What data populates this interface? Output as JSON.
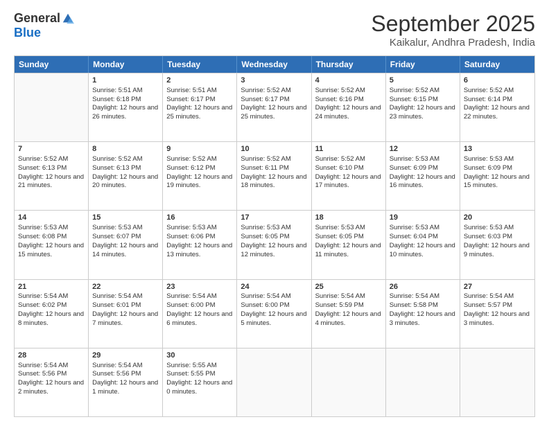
{
  "logo": {
    "general": "General",
    "blue": "Blue"
  },
  "title": "September 2025",
  "subtitle": "Kaikalur, Andhra Pradesh, India",
  "header_days": [
    "Sunday",
    "Monday",
    "Tuesday",
    "Wednesday",
    "Thursday",
    "Friday",
    "Saturday"
  ],
  "weeks": [
    [
      {
        "day": "",
        "sunrise": "",
        "sunset": "",
        "daylight": ""
      },
      {
        "day": "1",
        "sunrise": "Sunrise: 5:51 AM",
        "sunset": "Sunset: 6:18 PM",
        "daylight": "Daylight: 12 hours and 26 minutes."
      },
      {
        "day": "2",
        "sunrise": "Sunrise: 5:51 AM",
        "sunset": "Sunset: 6:17 PM",
        "daylight": "Daylight: 12 hours and 25 minutes."
      },
      {
        "day": "3",
        "sunrise": "Sunrise: 5:52 AM",
        "sunset": "Sunset: 6:17 PM",
        "daylight": "Daylight: 12 hours and 25 minutes."
      },
      {
        "day": "4",
        "sunrise": "Sunrise: 5:52 AM",
        "sunset": "Sunset: 6:16 PM",
        "daylight": "Daylight: 12 hours and 24 minutes."
      },
      {
        "day": "5",
        "sunrise": "Sunrise: 5:52 AM",
        "sunset": "Sunset: 6:15 PM",
        "daylight": "Daylight: 12 hours and 23 minutes."
      },
      {
        "day": "6",
        "sunrise": "Sunrise: 5:52 AM",
        "sunset": "Sunset: 6:14 PM",
        "daylight": "Daylight: 12 hours and 22 minutes."
      }
    ],
    [
      {
        "day": "7",
        "sunrise": "Sunrise: 5:52 AM",
        "sunset": "Sunset: 6:13 PM",
        "daylight": "Daylight: 12 hours and 21 minutes."
      },
      {
        "day": "8",
        "sunrise": "Sunrise: 5:52 AM",
        "sunset": "Sunset: 6:13 PM",
        "daylight": "Daylight: 12 hours and 20 minutes."
      },
      {
        "day": "9",
        "sunrise": "Sunrise: 5:52 AM",
        "sunset": "Sunset: 6:12 PM",
        "daylight": "Daylight: 12 hours and 19 minutes."
      },
      {
        "day": "10",
        "sunrise": "Sunrise: 5:52 AM",
        "sunset": "Sunset: 6:11 PM",
        "daylight": "Daylight: 12 hours and 18 minutes."
      },
      {
        "day": "11",
        "sunrise": "Sunrise: 5:52 AM",
        "sunset": "Sunset: 6:10 PM",
        "daylight": "Daylight: 12 hours and 17 minutes."
      },
      {
        "day": "12",
        "sunrise": "Sunrise: 5:53 AM",
        "sunset": "Sunset: 6:09 PM",
        "daylight": "Daylight: 12 hours and 16 minutes."
      },
      {
        "day": "13",
        "sunrise": "Sunrise: 5:53 AM",
        "sunset": "Sunset: 6:09 PM",
        "daylight": "Daylight: 12 hours and 15 minutes."
      }
    ],
    [
      {
        "day": "14",
        "sunrise": "Sunrise: 5:53 AM",
        "sunset": "Sunset: 6:08 PM",
        "daylight": "Daylight: 12 hours and 15 minutes."
      },
      {
        "day": "15",
        "sunrise": "Sunrise: 5:53 AM",
        "sunset": "Sunset: 6:07 PM",
        "daylight": "Daylight: 12 hours and 14 minutes."
      },
      {
        "day": "16",
        "sunrise": "Sunrise: 5:53 AM",
        "sunset": "Sunset: 6:06 PM",
        "daylight": "Daylight: 12 hours and 13 minutes."
      },
      {
        "day": "17",
        "sunrise": "Sunrise: 5:53 AM",
        "sunset": "Sunset: 6:05 PM",
        "daylight": "Daylight: 12 hours and 12 minutes."
      },
      {
        "day": "18",
        "sunrise": "Sunrise: 5:53 AM",
        "sunset": "Sunset: 6:05 PM",
        "daylight": "Daylight: 12 hours and 11 minutes."
      },
      {
        "day": "19",
        "sunrise": "Sunrise: 5:53 AM",
        "sunset": "Sunset: 6:04 PM",
        "daylight": "Daylight: 12 hours and 10 minutes."
      },
      {
        "day": "20",
        "sunrise": "Sunrise: 5:53 AM",
        "sunset": "Sunset: 6:03 PM",
        "daylight": "Daylight: 12 hours and 9 minutes."
      }
    ],
    [
      {
        "day": "21",
        "sunrise": "Sunrise: 5:54 AM",
        "sunset": "Sunset: 6:02 PM",
        "daylight": "Daylight: 12 hours and 8 minutes."
      },
      {
        "day": "22",
        "sunrise": "Sunrise: 5:54 AM",
        "sunset": "Sunset: 6:01 PM",
        "daylight": "Daylight: 12 hours and 7 minutes."
      },
      {
        "day": "23",
        "sunrise": "Sunrise: 5:54 AM",
        "sunset": "Sunset: 6:00 PM",
        "daylight": "Daylight: 12 hours and 6 minutes."
      },
      {
        "day": "24",
        "sunrise": "Sunrise: 5:54 AM",
        "sunset": "Sunset: 6:00 PM",
        "daylight": "Daylight: 12 hours and 5 minutes."
      },
      {
        "day": "25",
        "sunrise": "Sunrise: 5:54 AM",
        "sunset": "Sunset: 5:59 PM",
        "daylight": "Daylight: 12 hours and 4 minutes."
      },
      {
        "day": "26",
        "sunrise": "Sunrise: 5:54 AM",
        "sunset": "Sunset: 5:58 PM",
        "daylight": "Daylight: 12 hours and 3 minutes."
      },
      {
        "day": "27",
        "sunrise": "Sunrise: 5:54 AM",
        "sunset": "Sunset: 5:57 PM",
        "daylight": "Daylight: 12 hours and 3 minutes."
      }
    ],
    [
      {
        "day": "28",
        "sunrise": "Sunrise: 5:54 AM",
        "sunset": "Sunset: 5:56 PM",
        "daylight": "Daylight: 12 hours and 2 minutes."
      },
      {
        "day": "29",
        "sunrise": "Sunrise: 5:54 AM",
        "sunset": "Sunset: 5:56 PM",
        "daylight": "Daylight: 12 hours and 1 minute."
      },
      {
        "day": "30",
        "sunrise": "Sunrise: 5:55 AM",
        "sunset": "Sunset: 5:55 PM",
        "daylight": "Daylight: 12 hours and 0 minutes."
      },
      {
        "day": "",
        "sunrise": "",
        "sunset": "",
        "daylight": ""
      },
      {
        "day": "",
        "sunrise": "",
        "sunset": "",
        "daylight": ""
      },
      {
        "day": "",
        "sunrise": "",
        "sunset": "",
        "daylight": ""
      },
      {
        "day": "",
        "sunrise": "",
        "sunset": "",
        "daylight": ""
      }
    ]
  ]
}
